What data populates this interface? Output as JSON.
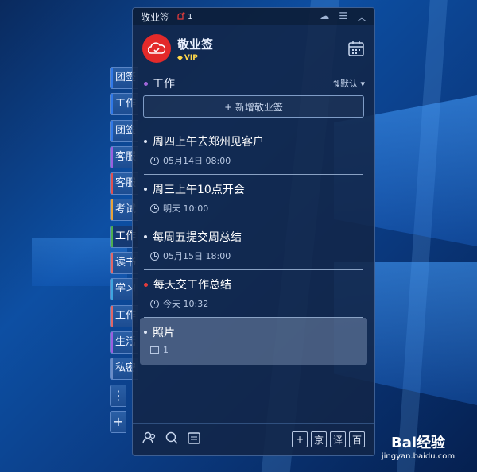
{
  "window": {
    "title": "敬业签",
    "notification_count": "1"
  },
  "user": {
    "name": "敬业签",
    "badge": "VIP"
  },
  "section": {
    "title": "工作",
    "sort_label": "⇅默认"
  },
  "add_button": "+ 新增敬业签",
  "items": [
    {
      "title": "周四上午去郑州见客户",
      "meta": "05月14日  08:00"
    },
    {
      "title": "周三上午10点开会",
      "meta": "明天  10:00"
    },
    {
      "title": "每周五提交周总结",
      "meta": "05月15日  18:00"
    },
    {
      "title": "每天交工作总结",
      "meta": "今天  10:32"
    },
    {
      "title": "照片",
      "meta": "1"
    }
  ],
  "tabs": [
    "团签",
    "工作",
    "团签",
    "客服",
    "客服",
    "考试",
    "工作",
    "读书",
    "学习",
    "工作",
    "生活",
    "私密",
    "⋮",
    "+"
  ],
  "tab_colors": [
    "#2f78e8",
    "#2f78e8",
    "#2f78e8",
    "#9a5de0",
    "#e05050",
    "#e7a33a",
    "#4caf50",
    "#e06666",
    "#3da5e0",
    "#e06666",
    "#9a5de0",
    "#6b8cc6",
    "#555",
    "#555"
  ],
  "footer_buttons": [
    "+",
    "京",
    "译",
    "百"
  ],
  "watermark": {
    "line1": "Bai经验",
    "line2": "jingyan.baidu.com"
  }
}
